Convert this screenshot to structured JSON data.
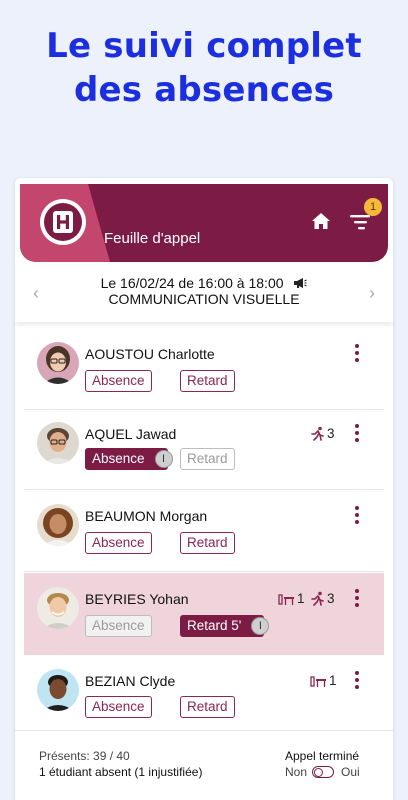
{
  "promo": {
    "line1": "Le suivi complet",
    "line2": "des absences"
  },
  "header": {
    "title": "Feuille d'appel",
    "logo_letter": "H",
    "notification_count": "1"
  },
  "session": {
    "datetime": "Le 16/02/24 de 16:00 à 18:00",
    "course": "COMMUNICATION VISUELLE"
  },
  "labels": {
    "absence": "Absence",
    "retard": "Retard"
  },
  "students": [
    {
      "name": "AOUSTOU Charlotte",
      "absence": "Absence",
      "retard": "Retard",
      "state": "none"
    },
    {
      "name": "AQUEL Jawad",
      "absence": "Absence",
      "retard": "Retard",
      "state": "absent",
      "run_count": "3"
    },
    {
      "name": "BEAUMON Morgan",
      "absence": "Absence",
      "retard": "Retard",
      "state": "none"
    },
    {
      "name": "BEYRIES Yohan",
      "absence": "Absence",
      "retard": "Retard 5'",
      "state": "late",
      "desk_count": "1",
      "run_count": "3"
    },
    {
      "name": "BEZIAN Clyde",
      "absence": "Absence",
      "retard": "Retard",
      "state": "none",
      "desk_count": "1"
    }
  ],
  "info_glyph": "I",
  "footer": {
    "present": "Présents: 39 / 40",
    "absent_summary": "1 étudiant absent (1 injustifiée)",
    "call_done": "Appel terminé",
    "no": "Non",
    "yes": "Oui"
  },
  "colors": {
    "brand": "#7c1c45",
    "brand_light": "#c2466e",
    "promo_blue": "#1b2ee0",
    "highlight_row": "#efd4dc",
    "badge": "#f5b83a"
  }
}
